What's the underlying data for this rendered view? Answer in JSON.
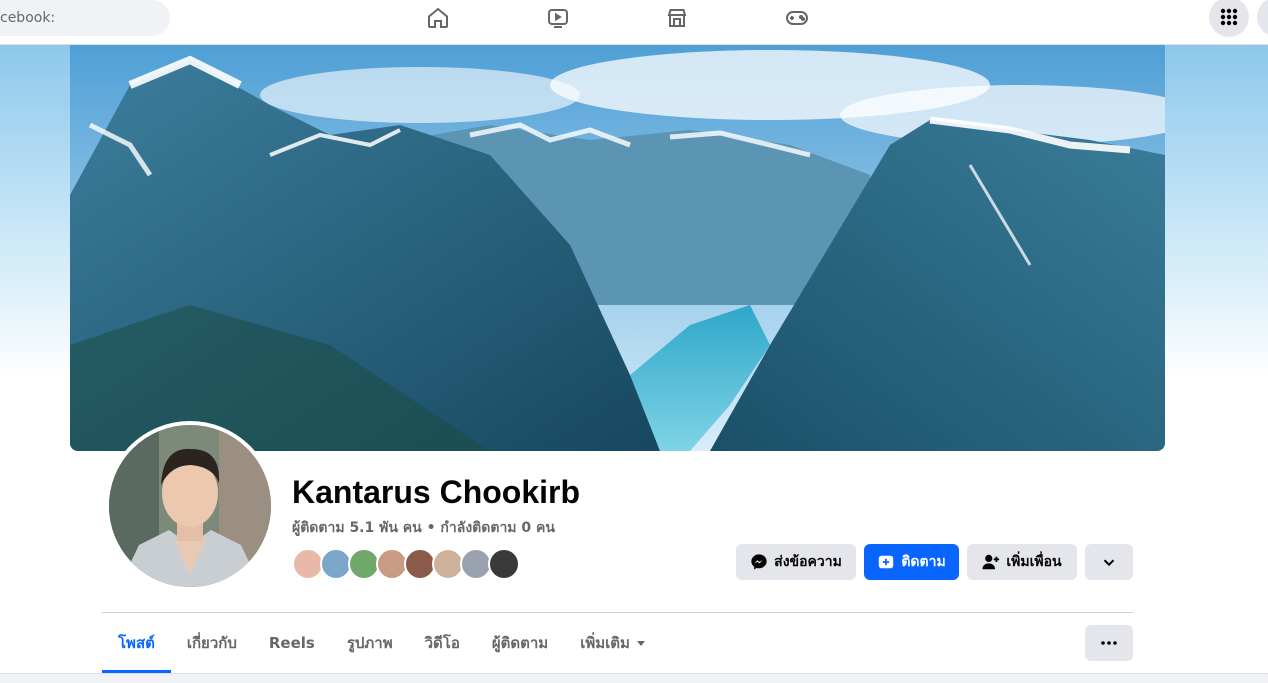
{
  "topnav": {
    "search_text": "cebook:",
    "icons": [
      "home-icon",
      "video-icon",
      "marketplace-icon",
      "gaming-icon",
      "menu-grid-icon"
    ]
  },
  "profile": {
    "name": "Kantarus Chookirb",
    "stats": "ผู้ติดตาม 5.1 พัน คน • กำลังติดตาม 0 คน",
    "friend_avatar_colors": [
      "#e8b9a8",
      "#7aa6c9",
      "#6fa86a",
      "#c99a86",
      "#8a5a4a",
      "#d0b29a",
      "#9aa3ad",
      "#3a3a3a"
    ]
  },
  "actions": {
    "message_label": "ส่งข้อความ",
    "follow_label": "ติดตาม",
    "add_friend_label": "เพิ่มเพื่อน"
  },
  "tabs": {
    "items": [
      {
        "label": "โพสต์",
        "active": true
      },
      {
        "label": "เกี่ยวกับ"
      },
      {
        "label": "Reels"
      },
      {
        "label": "รูปภาพ"
      },
      {
        "label": "วิดีโอ"
      },
      {
        "label": "ผู้ติดตาม"
      },
      {
        "label": "เพิ่มเติม"
      }
    ]
  },
  "colors": {
    "accent": "#0866ff",
    "button_gray": "#e4e6eb",
    "secondary_text": "#65676b"
  }
}
